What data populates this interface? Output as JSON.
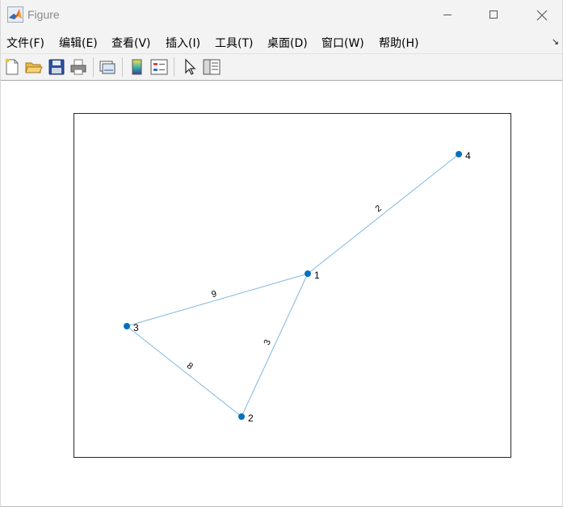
{
  "window": {
    "title": "Figure"
  },
  "menu": {
    "items": [
      {
        "label": "文件(F)"
      },
      {
        "label": "编辑(E)"
      },
      {
        "label": "查看(V)"
      },
      {
        "label": "插入(I)"
      },
      {
        "label": "工具(T)"
      },
      {
        "label": "桌面(D)"
      },
      {
        "label": "窗口(W)"
      },
      {
        "label": "帮助(H)"
      }
    ],
    "overflow_icon": "dock-arrow-icon"
  },
  "toolbar": {
    "buttons": [
      {
        "icon": "new-figure-icon"
      },
      {
        "icon": "open-file-icon"
      },
      {
        "icon": "save-icon"
      },
      {
        "icon": "print-icon"
      },
      {
        "icon": "link-plot-icon"
      },
      {
        "icon": "insert-colorbar-icon"
      },
      {
        "icon": "insert-legend-icon"
      },
      {
        "icon": "edit-plot-arrow-icon"
      },
      {
        "icon": "property-inspector-icon"
      }
    ]
  },
  "colors": {
    "node": "#0072BD",
    "edge": "#7FB8E0",
    "axes_border": "#262626"
  },
  "chart_data": {
    "type": "graph",
    "nodes": [
      {
        "id": "1"
      },
      {
        "id": "2"
      },
      {
        "id": "3"
      },
      {
        "id": "4"
      }
    ],
    "edges": [
      {
        "source": "1",
        "target": "4",
        "weight": "2"
      },
      {
        "source": "1",
        "target": "3",
        "weight": "9"
      },
      {
        "source": "1",
        "target": "2",
        "weight": "3"
      },
      {
        "source": "3",
        "target": "2",
        "weight": "8"
      }
    ]
  }
}
